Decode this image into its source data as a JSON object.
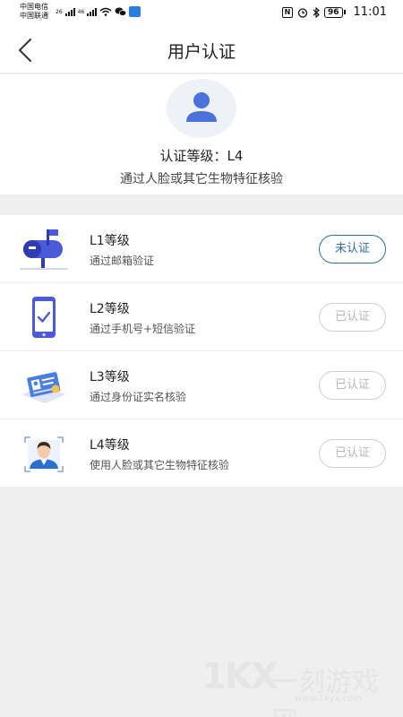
{
  "status_bar": {
    "carrier_1": "中国电信",
    "carrier_2": "中国联通",
    "net_1": "26",
    "net_2": "46",
    "battery": "96",
    "time": "11:01"
  },
  "nav": {
    "title": "用户认证"
  },
  "hero": {
    "level_text": "认证等级：L4",
    "desc": "通过人脸或其它生物特征核验"
  },
  "levels": [
    {
      "title": "L1等级",
      "desc": "通过邮箱验证",
      "status": "未认证",
      "icon": "mailbox-icon"
    },
    {
      "title": "L2等级",
      "desc": "通过手机号+短信验证",
      "status": "已认证",
      "icon": "phone-check-icon"
    },
    {
      "title": "L3等级",
      "desc": "通过身份证实名核验",
      "status": "已认证",
      "icon": "id-card-icon"
    },
    {
      "title": "L4等级",
      "desc": "使用人脸或其它生物特征核验",
      "status": "已认证",
      "icon": "face-scan-icon"
    }
  ],
  "watermark": {
    "logo": "1KX",
    "name": "一刻游戏网",
    "url": "www.1kyx.com"
  },
  "colors": {
    "accent": "#4a5ad8",
    "active_button": "#2f6d9c",
    "done_button": "#cfcfcf"
  }
}
